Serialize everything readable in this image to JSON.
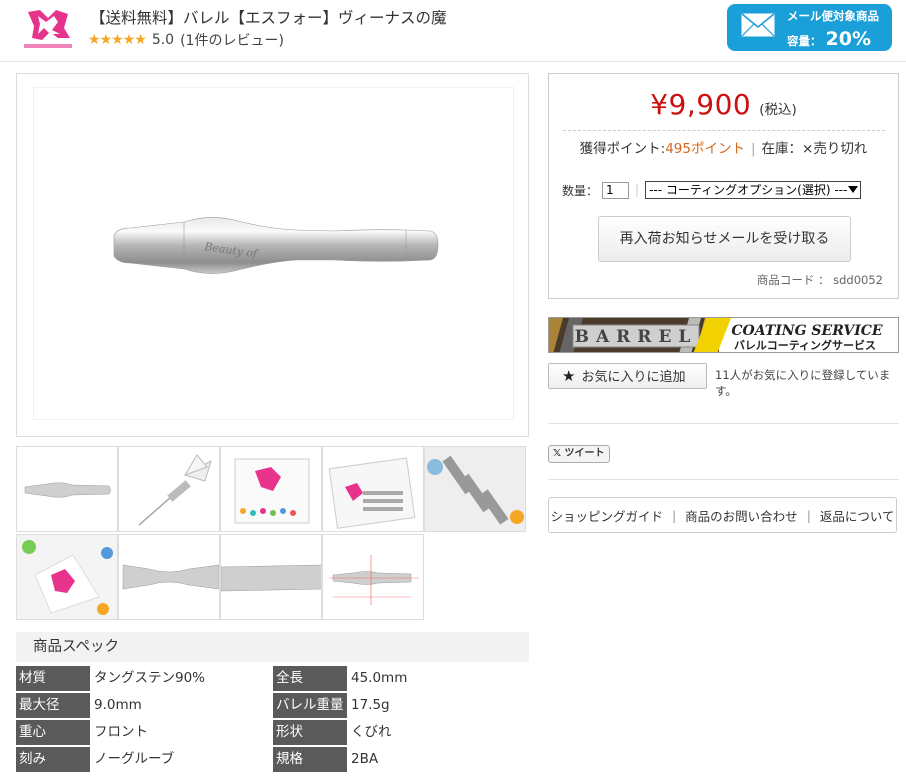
{
  "header": {
    "title": "【送料無料】バレル【エスフォー】ヴィーナスの魔",
    "rating_value": "5.0",
    "review_count": "(1件のレビュー)",
    "stars": 5,
    "mail_badge": {
      "line1": "メール便対象商品",
      "line2_prefix": "容量：",
      "line2_pct": "20%"
    }
  },
  "purchase": {
    "price": "¥9,900",
    "tax": "(税込)",
    "points_label": "獲得ポイント:",
    "points_value": "495ポイント",
    "stock_label": "在庫：",
    "stock_value": "×売り切れ",
    "qty_label": "数量：",
    "qty_value": "1",
    "option_selected": "--- コーティングオプション(選択) ---",
    "notify_button": "再入荷お知らせメールを受け取る",
    "product_code": "商品コード ： sdd0052"
  },
  "banner": {
    "barrel_text": "BARREL",
    "coating_en": "COATING SERVICE",
    "coating_jp": "バレルコーティングサービス"
  },
  "favorite": {
    "button": "お気に入りに追加",
    "note": "11人がお気に入りに登録しています。"
  },
  "tweet_label": "ツイート",
  "guide_links": [
    "ショッピングガイド",
    "商品のお問い合わせ",
    "返品について"
  ],
  "spec": {
    "heading": "商品スペック",
    "rows": [
      {
        "l1": "材質",
        "v1": "タングステン90%",
        "l2": "全長",
        "v2": "45.0mm"
      },
      {
        "l1": "最大径",
        "v1": "9.0mm",
        "l2": "バレル重量",
        "v2": "17.5g"
      },
      {
        "l1": "重心",
        "v1": "フロント",
        "l2": "形状",
        "v2": "くびれ"
      },
      {
        "l1": "刻み",
        "v1": "ノーグルーブ",
        "l2": "規格",
        "v2": "2BA"
      }
    ]
  },
  "colors": {
    "price_red": "#cc1111",
    "badge_blue": "#1b9fd9",
    "point_orange": "#d4651a",
    "spec_label_bg": "#5a5a5a"
  }
}
